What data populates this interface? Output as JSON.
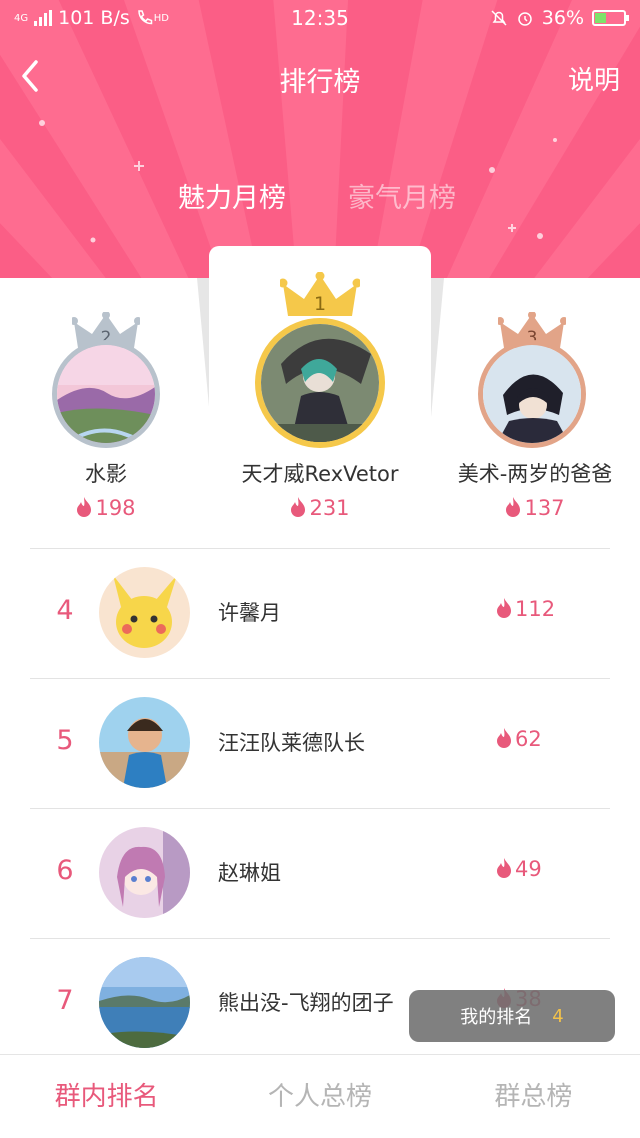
{
  "status_bar": {
    "network": "4G",
    "speed": "101 B/s",
    "hd": "HD",
    "time": "12:35",
    "battery": "36%"
  },
  "header": {
    "title": "排行榜",
    "help_label": "说明",
    "tabs": [
      {
        "label": "魅力月榜",
        "active": true
      },
      {
        "label": "豪气月榜",
        "active": false
      }
    ]
  },
  "top_three": [
    {
      "rank": "1",
      "name": "天才威RexVetor",
      "score": "231",
      "crown_color": "#f5c84a"
    },
    {
      "rank": "2",
      "name": "水影",
      "score": "198",
      "crown_color": "#b8c2cc"
    },
    {
      "rank": "3",
      "name": "美术-两岁的爸爸",
      "score": "137",
      "crown_color": "#e2a488"
    }
  ],
  "ranking_list": [
    {
      "rank": "4",
      "name": "许馨月",
      "score": "112"
    },
    {
      "rank": "5",
      "name": "汪汪队莱德队长",
      "score": "62"
    },
    {
      "rank": "6",
      "name": "赵琳姐",
      "score": "49"
    },
    {
      "rank": "7",
      "name": "熊出没-飞翔的团子",
      "score": "38"
    }
  ],
  "my_rank": {
    "label": "我的排名",
    "value": "4"
  },
  "bottom_nav": [
    {
      "label": "群内排名",
      "active": true
    },
    {
      "label": "个人总榜",
      "active": false
    },
    {
      "label": "群总榜",
      "active": false
    }
  ],
  "colors": {
    "header_pink": "#fb5e86",
    "accent_pink": "#e8597b",
    "gold": "#f5c84a",
    "silver": "#b8c2cc",
    "bronze": "#e2a488"
  }
}
